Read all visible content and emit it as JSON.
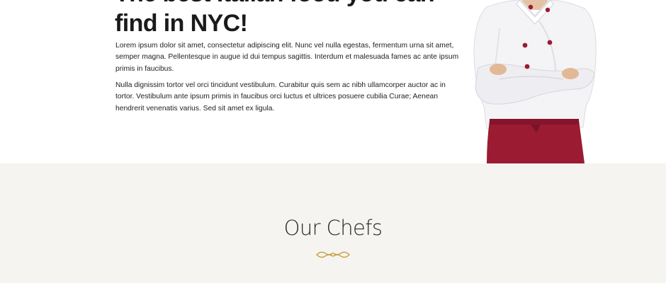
{
  "about": {
    "headline": "The best Italian food you can find in NYC!",
    "paragraphs": [
      "Lorem ipsum dolor sit amet, consectetur adipiscing elit. Nunc vel nulla egestas, fermentum urna sit amet, semper magna. Pellentesque in augue id dui tempus sagittis. Interdum et malesuada fames ac ante ipsum primis in faucibus.",
      "Nulla dignissim tortor vel orci tincidunt vestibulum. Curabitur quis sem ac nibh ullamcorper auctor ac in tortor. Vestibulum ante ipsum primis in faucibus orci luctus et ultrices posuere cubilia Curae; Aenean hendrerit venenatis varius. Sed sit amet ex ligula."
    ]
  },
  "chefs": {
    "title": "Our Chefs"
  },
  "colors": {
    "section_background": "#f6f4f0",
    "divider_gold": "#c9a24a",
    "apron": "#9b1b32",
    "jacket": "#f4f4f6",
    "buttons": "#9b1b32"
  },
  "icons": {
    "divider": "ornament-flourish-icon"
  }
}
